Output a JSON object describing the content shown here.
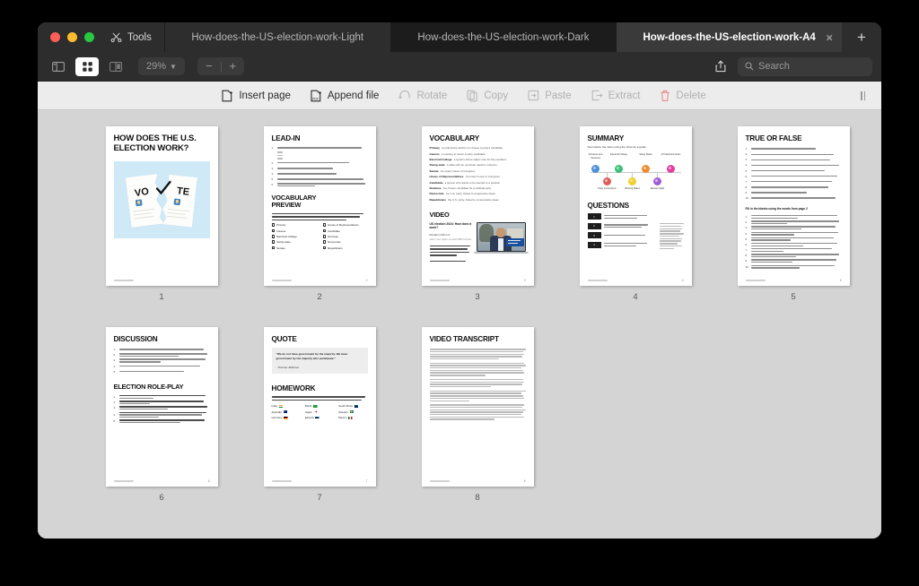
{
  "window": {
    "traffic_lights": [
      "close",
      "minimize",
      "maximize"
    ],
    "tools_label": "Tools"
  },
  "tabs": [
    {
      "label": "How-does-the-US-election-work-Light",
      "active": false
    },
    {
      "label": "How-does-the-US-election-work-Dark",
      "active": false
    },
    {
      "label": "How-does-the-US-election-work-A4",
      "active": true,
      "close": "×"
    }
  ],
  "new_tab_label": "+",
  "toolbar": {
    "zoom_level": "29%",
    "zoom_out": "−",
    "zoom_in": "+",
    "search_placeholder": "Search",
    "view_modes": [
      "sidebar-view",
      "grid-view",
      "split-view"
    ],
    "selected_view_mode": "grid-view"
  },
  "actions": [
    {
      "label": "Insert page",
      "icon": "insert-page-icon",
      "enabled": true
    },
    {
      "label": "Append file",
      "icon": "append-file-icon",
      "enabled": true
    },
    {
      "label": "Rotate",
      "icon": "rotate-icon",
      "enabled": false
    },
    {
      "label": "Copy",
      "icon": "copy-icon",
      "enabled": false
    },
    {
      "label": "Paste",
      "icon": "paste-icon",
      "enabled": false
    },
    {
      "label": "Extract",
      "icon": "extract-icon",
      "enabled": false
    },
    {
      "label": "Delete",
      "icon": "delete-icon",
      "enabled": false
    }
  ],
  "colors": {
    "accent_blue": "#4a90d9",
    "delete_red": "#e98b8b",
    "cover_bg": "#cfe9f7",
    "timeline": [
      "#4a90d9",
      "#e05c5c",
      "#3bbf7a",
      "#f2d02c",
      "#ef8b2c",
      "#a45bd6",
      "#e23fa0"
    ]
  },
  "pages": [
    {
      "number": "1",
      "type": "cover",
      "title": "HOW DOES THE U.S. ELECTION WORK?",
      "image_words": {
        "left": "VO",
        "right": "TE"
      }
    },
    {
      "number": "2",
      "type": "lead-in",
      "title": "LEAD-IN",
      "questions": [
        "U.S. Election 2024: Share three things you know about it.",
        "Who are the two main political parties in the U.S.?",
        "Have you ever followed a U.S. election?",
        "Can you name any past U.S. presidents?",
        "Why do you think U.S. elections get so much global attention?",
        "What impact do you think younger voters have on elections compared to older generations?"
      ],
      "subtitle": "VOCABULARY PREVIEW",
      "instruction": "Put a tick in the box next to the words you're familiar with and provide a brief explanation for each. Then, discuss the unfamiliar words on the next page.",
      "vocab_left": [
        "Primary",
        "Caucus",
        "Electoral College",
        "Swing state",
        "Senate"
      ],
      "vocab_right": [
        "House of Representatives",
        "Candidate",
        "Nominee",
        "Democrats",
        "Republicans"
      ],
      "page_label": "2"
    },
    {
      "number": "3",
      "type": "vocabulary",
      "title": "VOCABULARY",
      "definitions": [
        {
          "term": "Primary",
          "desc": "a preliminary election to choose a party's candidate"
        },
        {
          "term": "Caucus",
          "desc": "a meeting to select a party candidate"
        },
        {
          "term": "Electoral College",
          "desc": "a system where states vote for the president"
        },
        {
          "term": "Swing state",
          "desc": "a state with an uncertain election outcome"
        },
        {
          "term": "Senate",
          "desc": "the upper house of Congress"
        },
        {
          "term": "House of Representatives",
          "desc": "the lower house of Congress"
        },
        {
          "term": "Candidate",
          "desc": "a person who wants to be elected to a position"
        },
        {
          "term": "Nominee",
          "desc": "the chosen candidate for a political party"
        },
        {
          "term": "Democrats",
          "desc": "the U.S. party, linked to progressive ideas"
        },
        {
          "term": "Republicans",
          "desc": "the U.S. party, linked to conservative ideas"
        }
      ],
      "video_title": "VIDEO",
      "video_heading": "US election 2024: How does it work?",
      "video_duration": "Duration 3:30 min",
      "video_source": "Video / Cue caption on watch BBC/YouTube",
      "video_instruction": "While watching the video, listen for the election-related vocabulary discussed earlier and note how they are used in context.",
      "video_note": "Then proceed to the next page.",
      "page_label": "3"
    },
    {
      "number": "4",
      "type": "summary",
      "title": "SUMMARY",
      "instruction": "Summarize the video using the chart as a guide",
      "timeline_top": [
        "Primaries and Caucuses",
        "Electoral College",
        "Swing States",
        "270 Electoral Votes"
      ],
      "timeline_bottom": [
        "Party Conventions",
        "Winning States",
        "Election Night"
      ],
      "questions_title": "QUESTIONS",
      "questions": [
        {
          "n": "1",
          "text": "How do candidates become nominees for their parties?"
        },
        {
          "n": "2",
          "text": "What is the Electoral College, and how does it work?"
        },
        {
          "n": "3",
          "text": "Why are swing states important?"
        },
        {
          "n": "4",
          "text": "How many electoral votes are needed to win the election?"
        }
      ],
      "note": "California is huge; it has 54 total senators and it has 52 representatives, which adds up to 54 Electoral College votes.",
      "page_label": "4"
    },
    {
      "number": "5",
      "type": "true-false",
      "title": "TRUE OR FALSE",
      "statements": [
        "The US election involves three main parties.",
        "Primaries and caucuses are used to select candidates for president.",
        "The Electoral College is based on the population of each state.",
        "Each state has two representatives in the House of Representatives.",
        "California has more Electoral College votes than Vermont.",
        "A total of 538 Electoral College votes are available in the US election.",
        "To win the presidency, a candidate needs 300 Electoral College votes.",
        "Swing states are those that always vote for the same party.",
        "The Senate is the lower house of Congress.",
        "Individual counties in swing states can affect the election outcome."
      ],
      "fill_title": "Fill in the blanks using the words from page 2",
      "page_label": "5"
    },
    {
      "number": "6",
      "type": "discussion",
      "title": "DISCUSSION",
      "questions": [
        "In your view, what qualities make a good presidential candidate?",
        "How important is it for candidates to have experience in government or politics before running for president?",
        "What are some advantages and disadvantages of having two main political parties in the U.S.?",
        "Do you think debates among candidates influence voters' decisions?",
        "In your opinion, should voting be mandatory?"
      ],
      "roleplay_title": "ELECTION ROLE-PLAY",
      "roleplay_steps": [
        {
          "term": "Form Two Groups:",
          "desc": "Divide yourselves into two groups: Democrats and Republicans."
        },
        {
          "term": "Nominate a Candidate:",
          "desc": "Each group will nominate a \"candidate\" for president."
        },
        {
          "term": "Present Your Candidate:",
          "desc": "You will have 2 minutes to present why your candidate should win the election."
        },
        {
          "term": "Select the Electoral College:",
          "desc": "Choose one student to act as the \"Electoral College.\" This student will decide the winner based on the group presentations."
        },
        {
          "term": "Determine the Winner:",
          "desc": "Alternatively, if you want a swing-state-style scenario, you can flip a coin to determine the winner."
        }
      ],
      "page_label": "6"
    },
    {
      "number": "7",
      "type": "quote",
      "title": "QUOTE",
      "quote_text": "\"We do not have government by the majority. We have government by the majority who participate.\"",
      "quote_author": "- Thomas Jefferson",
      "homework_title": "HOMEWORK",
      "homework_instruction": "Research the election process of another country and write a short summary (100-150 words) comparing it with the US election.",
      "countries_col1": [
        "India",
        "Australia",
        "Germany"
      ],
      "countries_col2": [
        "Brazil",
        "Japan",
        "Estonia"
      ],
      "countries_col3": [
        "South Africa",
        "Sweden",
        "Mexico"
      ],
      "page_label": "7"
    },
    {
      "number": "8",
      "type": "transcript",
      "title": "VIDEO TRANSCRIPT",
      "paragraph_count": 6,
      "page_label": "8"
    }
  ]
}
